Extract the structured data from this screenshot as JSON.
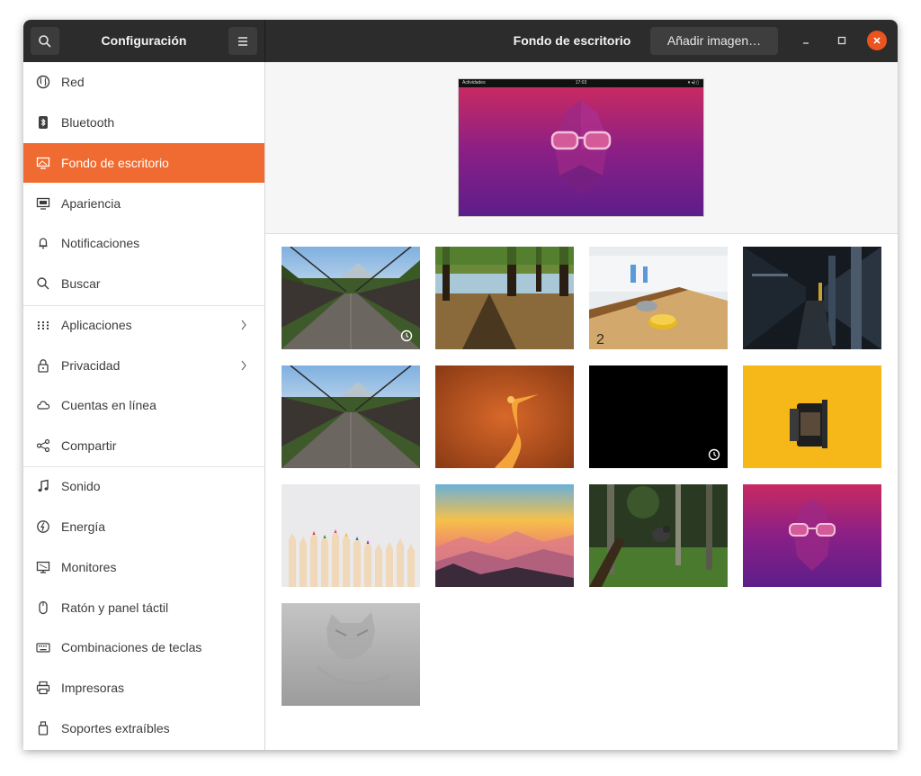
{
  "header": {
    "sidebar_title": "Configuración",
    "page_title": "Fondo de escritorio",
    "add_image_label": "Añadir imagen…"
  },
  "sidebar": {
    "items": [
      {
        "label": "Red",
        "icon": "network-icon"
      },
      {
        "label": "Bluetooth",
        "icon": "bluetooth-icon"
      },
      {
        "label": "Fondo de escritorio",
        "icon": "background-icon",
        "active": true
      },
      {
        "label": "Apariencia",
        "icon": "appearance-icon"
      },
      {
        "label": "Notificaciones",
        "icon": "bell-icon"
      },
      {
        "label": "Buscar",
        "icon": "search-icon"
      },
      {
        "label": "Aplicaciones",
        "icon": "apps-grid-icon",
        "has_submenu": true
      },
      {
        "label": "Privacidad",
        "icon": "lock-icon",
        "has_submenu": true
      },
      {
        "label": "Cuentas en línea",
        "icon": "cloud-icon"
      },
      {
        "label": "Compartir",
        "icon": "share-icon"
      },
      {
        "label": "Sonido",
        "icon": "music-note-icon"
      },
      {
        "label": "Energía",
        "icon": "power-icon"
      },
      {
        "label": "Monitores",
        "icon": "monitor-icon"
      },
      {
        "label": "Ratón y panel táctil",
        "icon": "mouse-icon"
      },
      {
        "label": "Combinaciones de teclas",
        "icon": "keyboard-icon"
      },
      {
        "label": "Impresoras",
        "icon": "printer-icon"
      },
      {
        "label": "Soportes extraíbles",
        "icon": "usb-drive-icon"
      }
    ]
  },
  "preview": {
    "topbar_left": "Actividades",
    "topbar_clock": "17:03",
    "topbar_status": "▾ ◂) ▯"
  },
  "wallpapers": [
    {
      "name": "bridge-forest",
      "timed": true
    },
    {
      "name": "forest-lake-shadows",
      "timed": false
    },
    {
      "name": "shuffleboard-table",
      "timed": false
    },
    {
      "name": "subway-station",
      "timed": false
    },
    {
      "name": "bridge-forest-2",
      "timed": false
    },
    {
      "name": "orange-heron",
      "timed": false
    },
    {
      "name": "black-timed",
      "timed": true
    },
    {
      "name": "film-roll-yellow",
      "timed": false
    },
    {
      "name": "colored-pencils",
      "timed": false
    },
    {
      "name": "sunset-mountains",
      "timed": false
    },
    {
      "name": "gorilla-jungle",
      "timed": false
    },
    {
      "name": "purple-gorilla",
      "timed": false
    },
    {
      "name": "grey-fossa",
      "timed": false
    }
  ],
  "colors": {
    "accent": "#f06b31",
    "header_bg": "#2c2c2c",
    "close_button": "#e95420"
  }
}
